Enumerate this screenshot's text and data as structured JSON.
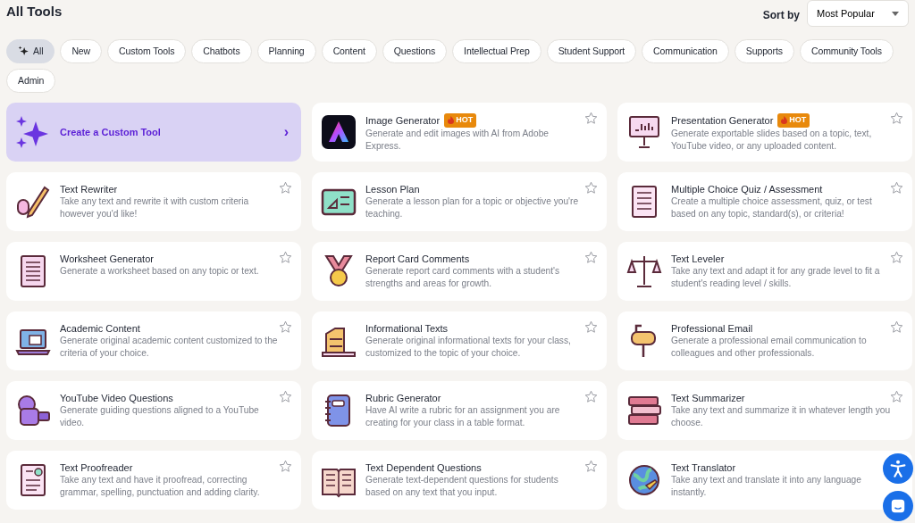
{
  "page_title": "All Tools",
  "sort": {
    "label": "Sort by",
    "value": "Most Popular"
  },
  "filters": [
    {
      "label": "All",
      "selected": true
    },
    {
      "label": "New",
      "selected": false
    },
    {
      "label": "Custom Tools",
      "selected": false
    },
    {
      "label": "Chatbots",
      "selected": false
    },
    {
      "label": "Planning",
      "selected": false
    },
    {
      "label": "Content",
      "selected": false
    },
    {
      "label": "Questions",
      "selected": false
    },
    {
      "label": "Intellectual Prep",
      "selected": false
    },
    {
      "label": "Student Support",
      "selected": false
    },
    {
      "label": "Communication",
      "selected": false
    },
    {
      "label": "Supports",
      "selected": false
    },
    {
      "label": "Community Tools",
      "selected": false
    },
    {
      "label": "Admin",
      "selected": false
    }
  ],
  "create_tool": {
    "label": "Create a Custom Tool",
    "arrow": "›"
  },
  "tools": [
    {
      "title": "Image Generator",
      "badge": "HOT",
      "description": "Generate and edit images with AI from Adobe Express.",
      "favorited": false
    },
    {
      "title": "Presentation Generator",
      "badge": "HOT",
      "description": "Generate exportable slides based on a topic, text, YouTube video, or any uploaded content.",
      "favorited": false
    },
    {
      "title": "Text Rewriter",
      "description": "Take any text and rewrite it with custom criteria however you'd like!",
      "favorited": false
    },
    {
      "title": "Lesson Plan",
      "description": "Generate a lesson plan for a topic or objective you're teaching.",
      "favorited": false
    },
    {
      "title": "Multiple Choice Quiz / Assessment",
      "description": "Create a multiple choice assessment, quiz, or test based on any topic, standard(s), or criteria!",
      "favorited": false
    },
    {
      "title": "Worksheet Generator",
      "description": "Generate a worksheet based on any topic or text.",
      "favorited": false
    },
    {
      "title": "Report Card Comments",
      "description": "Generate report card comments with a student's strengths and areas for growth.",
      "favorited": false
    },
    {
      "title": "Text Leveler",
      "description": "Take any text and adapt it for any grade level to fit a student's reading level / skills.",
      "favorited": false
    },
    {
      "title": "Academic Content",
      "description": "Generate original academic content customized to the criteria of your choice.",
      "favorited": false
    },
    {
      "title": "Informational Texts",
      "description": "Generate original informational texts for your class, customized to the topic of your choice.",
      "favorited": false
    },
    {
      "title": "Professional Email",
      "description": "Generate a professional email communication to colleagues and other professionals.",
      "favorited": false
    },
    {
      "title": "YouTube Video Questions",
      "description": "Generate guiding questions aligned to a YouTube video.",
      "favorited": false
    },
    {
      "title": "Rubric Generator",
      "description": "Have AI write a rubric for an assignment you are creating for your class in a table format.",
      "favorited": false
    },
    {
      "title": "Text Summarizer",
      "description": "Take any text and summarize it in whatever length you choose.",
      "favorited": false
    },
    {
      "title": "Text Proofreader",
      "description": "Take any text and have it proofread, correcting grammar, spelling, punctuation and adding clarity.",
      "favorited": false
    },
    {
      "title": "Text Dependent Questions",
      "description": "Generate text-dependent questions for students based on any text that you input.",
      "favorited": false
    },
    {
      "title": "Text Translator",
      "description": "Take any text and translate it into any language instantly."
    }
  ]
}
